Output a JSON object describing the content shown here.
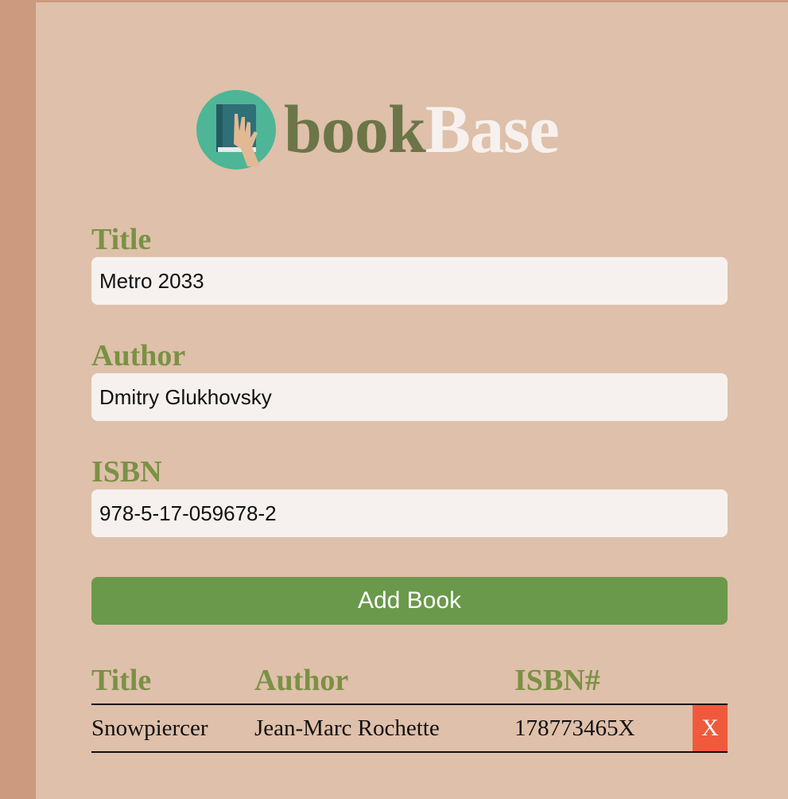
{
  "app": {
    "logo_word_primary": "book",
    "logo_word_secondary": "Base",
    "logo_icon": "book-hand-icon"
  },
  "form": {
    "title_label": "Title",
    "title_value": "Metro 2033",
    "author_label": "Author",
    "author_value": "Dmitry Glukhovsky",
    "isbn_label": "ISBN",
    "isbn_value": "978-5-17-059678-2",
    "submit_label": "Add Book"
  },
  "table": {
    "headers": {
      "title": "Title",
      "author": "Author",
      "isbn": "ISBN#"
    },
    "rows": [
      {
        "title": "Snowpiercer",
        "author": "Jean-Marc Rochette",
        "isbn": "178773465X",
        "delete_label": "X"
      }
    ]
  },
  "colors": {
    "background": "#cc9a7f",
    "panel": "#dfc0aa",
    "label_green": "#7a9144",
    "button_green": "#6a994b",
    "delete_red": "#f05a3c"
  }
}
